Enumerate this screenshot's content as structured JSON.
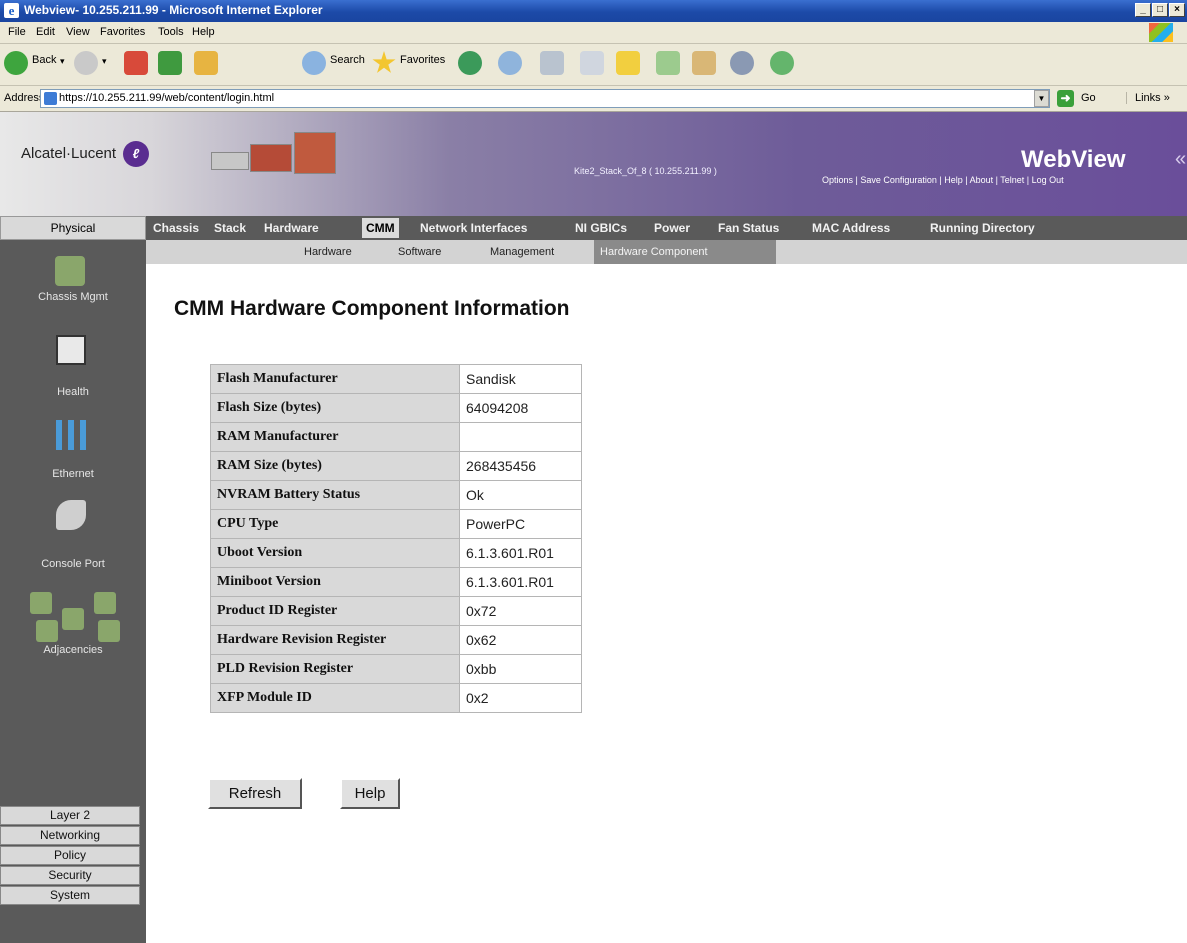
{
  "window": {
    "title": "Webview- 10.255.211.99 - Microsoft Internet Explorer",
    "controls": [
      "_",
      "□",
      "×"
    ]
  },
  "menu": [
    "File",
    "Edit",
    "View",
    "Favorites",
    "Tools",
    "Help"
  ],
  "toolbar": {
    "back": "Back",
    "search": "Search",
    "favorites": "Favorites"
  },
  "address": {
    "label": "Address",
    "url": "https://10.255.211.99/web/content/login.html",
    "go": "Go",
    "links": "Links »"
  },
  "banner": {
    "logo": "Alcatel·Lucent",
    "device": "Kite2_Stack_Of_8 ( 10.255.211.99 )",
    "brand": "WebView",
    "brand_suffix": "«",
    "links": "Options | Save Configuration | Help | About | Telnet | Log Out"
  },
  "nav": {
    "physical": "Physical",
    "main": [
      "Chassis",
      "Stack",
      "Hardware",
      "CMM",
      "Network Interfaces",
      "NI GBICs",
      "Power",
      "Fan Status",
      "MAC Address",
      "Running Directory"
    ],
    "sub": [
      "Hardware",
      "Software",
      "Management",
      "Hardware Component"
    ]
  },
  "sidebar": {
    "items": [
      "Chassis Mgmt",
      "Health",
      "Ethernet",
      "Console Port",
      "Adjacencies"
    ],
    "bottom": [
      "Layer 2",
      "Networking",
      "Policy",
      "Security",
      "System"
    ]
  },
  "content": {
    "title": "CMM Hardware Component Information",
    "rows": [
      {
        "label": "Flash Manufacturer",
        "value": "Sandisk"
      },
      {
        "label": "Flash Size (bytes)",
        "value": "64094208"
      },
      {
        "label": "RAM Manufacturer",
        "value": ""
      },
      {
        "label": "RAM Size (bytes)",
        "value": "268435456"
      },
      {
        "label": "NVRAM Battery Status",
        "value": "Ok"
      },
      {
        "label": "CPU Type",
        "value": "PowerPC"
      },
      {
        "label": "Uboot Version",
        "value": "6.1.3.601.R01"
      },
      {
        "label": "Miniboot Version",
        "value": "6.1.3.601.R01"
      },
      {
        "label": "Product ID Register",
        "value": "0x72"
      },
      {
        "label": "Hardware Revision Register",
        "value": "0x62"
      },
      {
        "label": "PLD Revision Register",
        "value": "0xbb"
      },
      {
        "label": "XFP Module ID",
        "value": "0x2"
      }
    ],
    "refresh": "Refresh",
    "help": "Help"
  }
}
